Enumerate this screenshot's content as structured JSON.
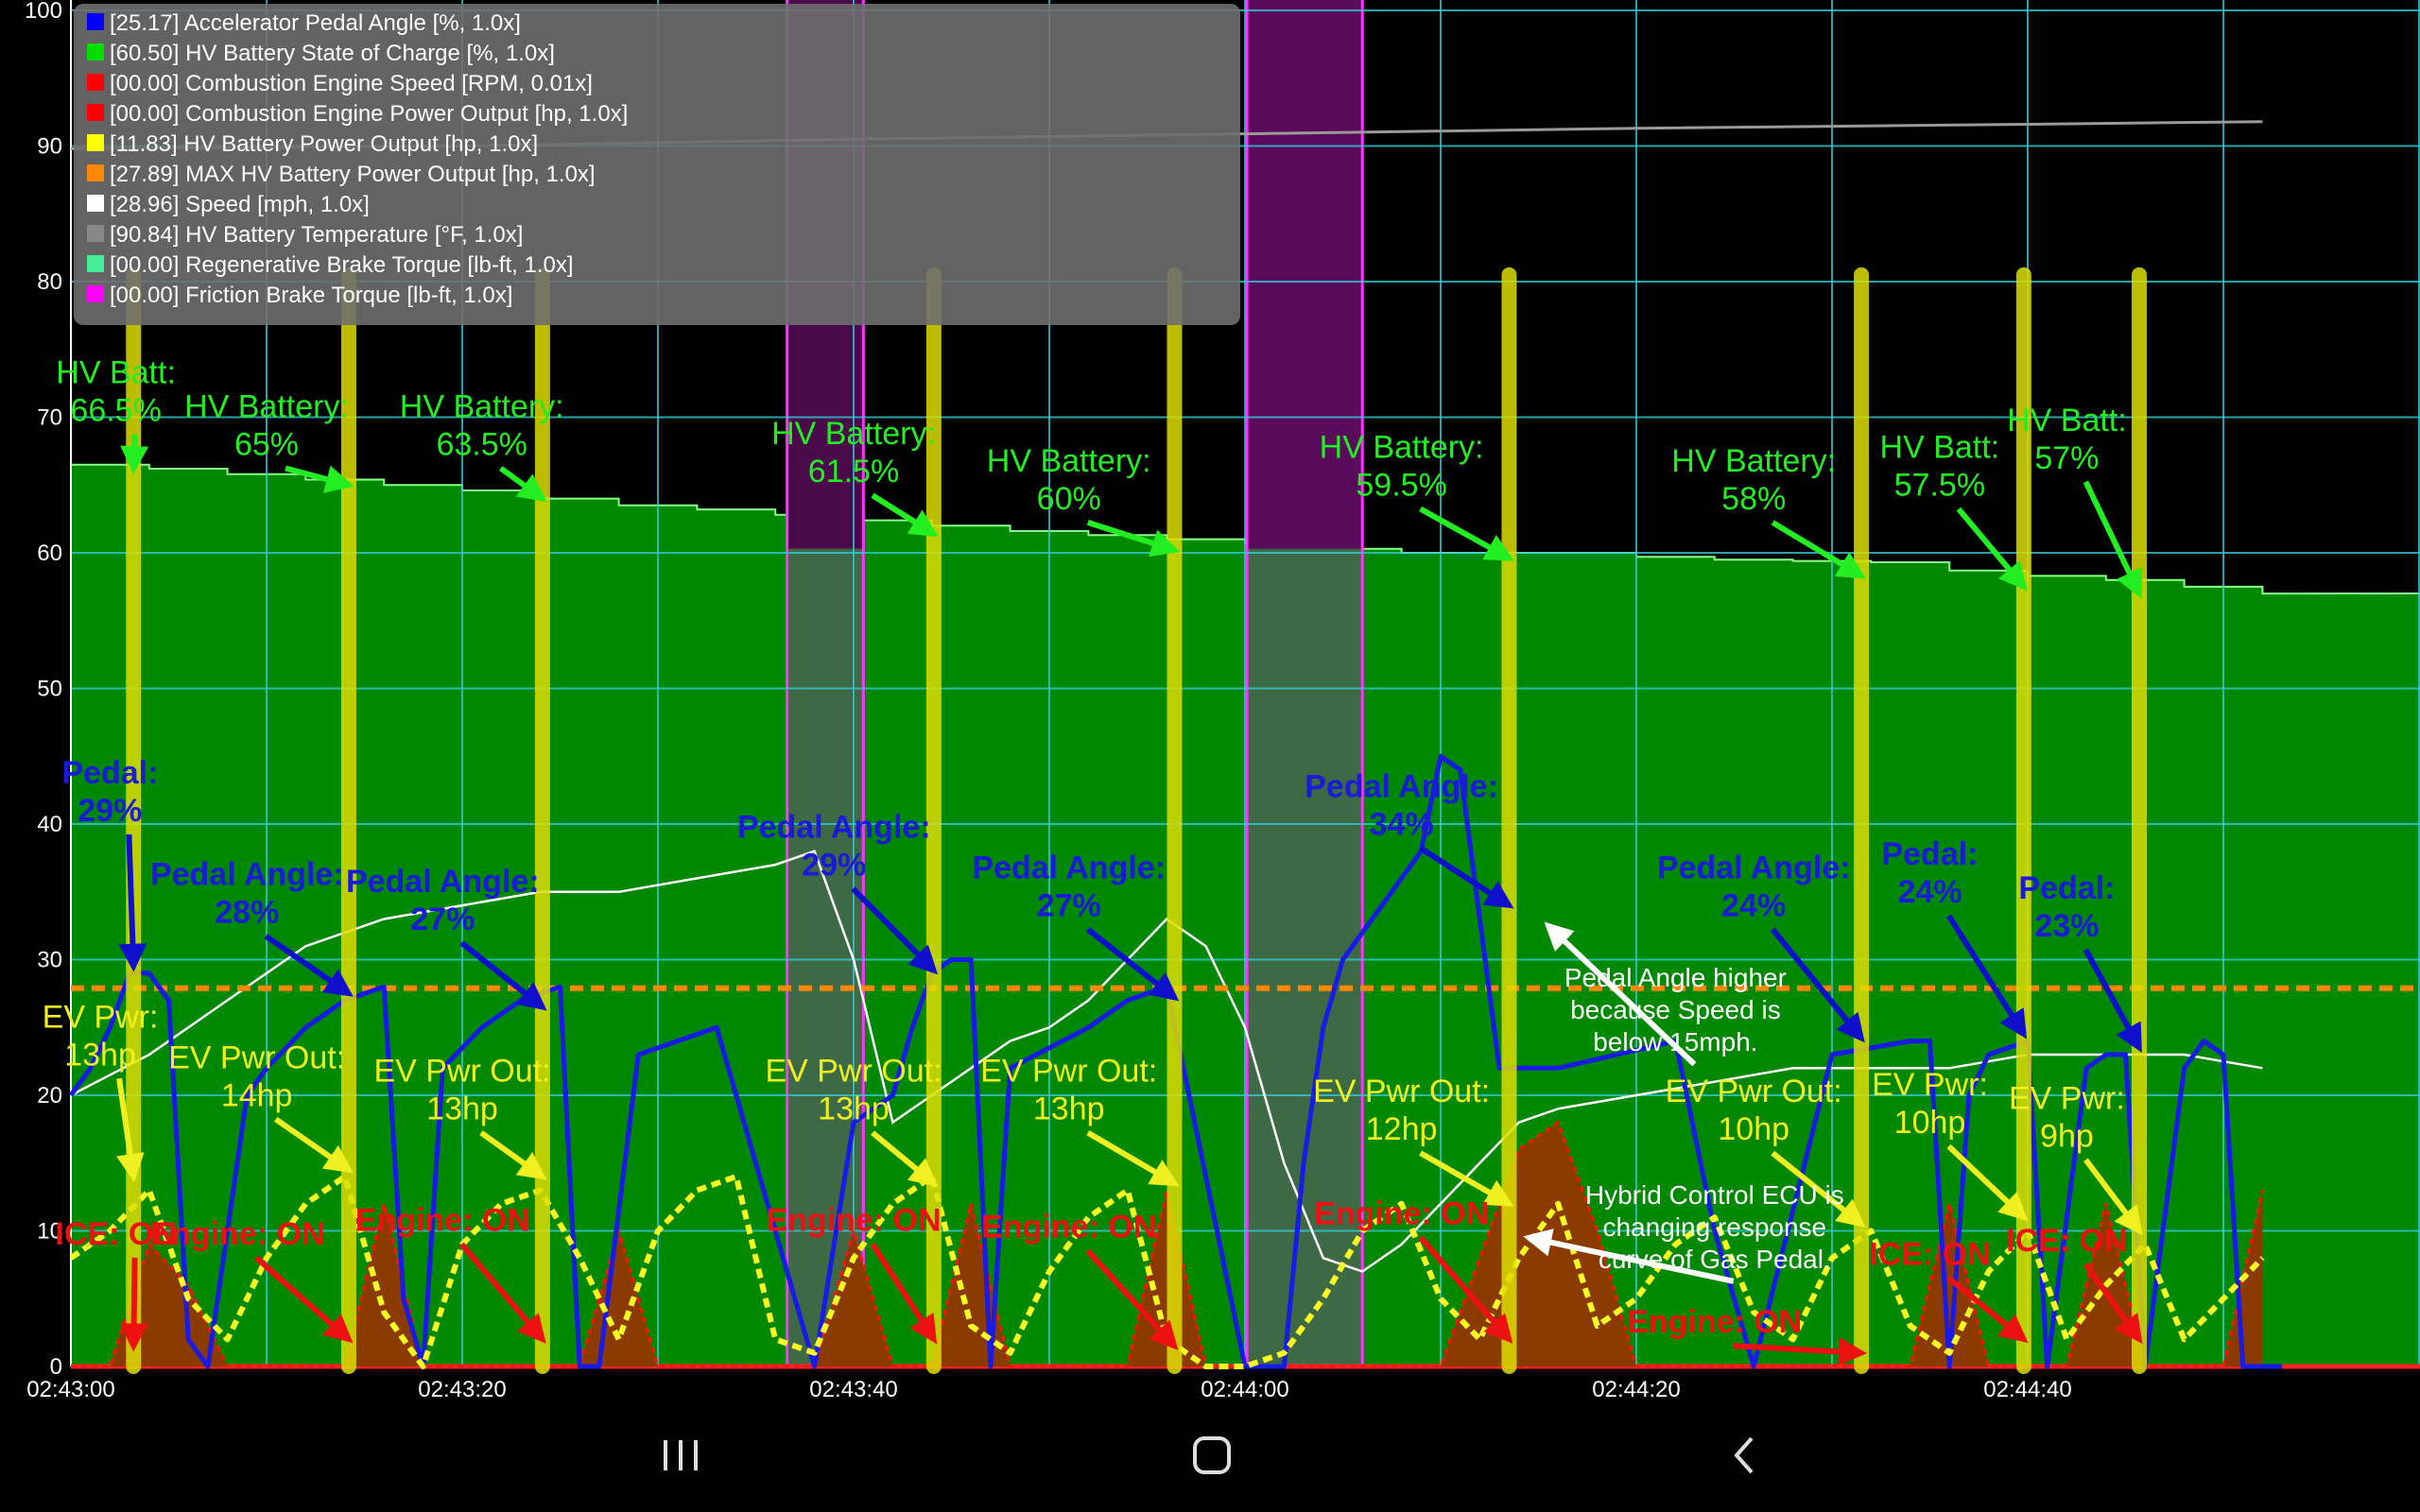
{
  "chart_data": {
    "type": "line",
    "ylim": [
      0,
      100
    ],
    "y_ticks": [
      "0",
      "10",
      "20",
      "30",
      "40",
      "50",
      "60",
      "70",
      "80",
      "90",
      "100"
    ],
    "x_tick_labels": [
      "02:43:00",
      "02:43:20",
      "02:43:40",
      "02:44:00",
      "02:44:20",
      "02:44:40"
    ],
    "legend": [
      {
        "text": "[25.17] Accelerator Pedal Angle [%, 1.0x]",
        "color": "#0000ff"
      },
      {
        "text": "[60.50] HV Battery State of Charge [%, 1.0x]",
        "color": "#00dd00"
      },
      {
        "text": "[00.00] Combustion Engine Speed [RPM, 0.01x]",
        "color": "#ff0000"
      },
      {
        "text": "[00.00] Combustion Engine Power Output [hp, 1.0x]",
        "color": "#ff0000"
      },
      {
        "text": "[11.83] HV Battery Power Output [hp, 1.0x]",
        "color": "#ffff00"
      },
      {
        "text": "[27.89] MAX HV Battery Power Output [hp, 1.0x]",
        "color": "#ff8800"
      },
      {
        "text": "[28.96] Speed [mph, 1.0x]",
        "color": "#ffffff"
      },
      {
        "text": "[90.84] HV Battery Temperature [°F, 1.0x]",
        "color": "#888888"
      },
      {
        "text": "[00.00] Regenerative Brake Torque [lb-ft, 1.0x]",
        "color": "#44ee99"
      },
      {
        "text": "[00.00] Friction Brake Torque [lb-ft, 1.0x]",
        "color": "#ff00ff"
      }
    ],
    "series": [
      {
        "name": "HV Battery State of Charge",
        "x": [
          0,
          4,
          8,
          12,
          16,
          20,
          24,
          28,
          32,
          36,
          40,
          44,
          48,
          52,
          56,
          60,
          64,
          68,
          72,
          76,
          80,
          84,
          88,
          92,
          96,
          100,
          104,
          108,
          112
        ],
        "values": [
          66.5,
          66.2,
          65.8,
          65.4,
          65.0,
          64.6,
          64.0,
          63.5,
          63.2,
          62.8,
          62.4,
          62.0,
          61.6,
          61.3,
          61.0,
          60.7,
          60.3,
          60.0,
          60.0,
          60.0,
          59.7,
          59.5,
          59.4,
          59.3,
          58.7,
          58.3,
          58.0,
          57.5,
          57.0
        ]
      },
      {
        "name": "Accelerator Pedal Angle",
        "x": [
          0,
          1,
          2,
          3,
          4,
          5,
          6,
          7,
          9,
          10,
          12,
          14,
          15,
          16,
          17,
          18,
          19,
          21,
          23,
          24,
          25,
          26,
          27,
          29,
          31,
          33,
          38,
          40,
          42,
          43,
          44,
          45,
          46,
          47,
          48,
          52,
          54,
          56,
          60,
          62,
          63,
          64,
          65,
          67,
          69,
          70,
          71,
          73,
          76,
          79,
          82,
          84,
          86,
          90,
          94,
          95,
          96,
          97,
          98,
          100,
          101,
          103,
          104,
          105,
          106,
          108,
          109,
          110,
          111,
          112,
          113
        ],
        "values": [
          20,
          22,
          25,
          29,
          29,
          27,
          2,
          0,
          20,
          22,
          25,
          27,
          27.5,
          28,
          5,
          0,
          22,
          25,
          27,
          27.5,
          28,
          0,
          0,
          23,
          24,
          25,
          0,
          18,
          20,
          25,
          29,
          30,
          30,
          0,
          22,
          25,
          27,
          28,
          0,
          0,
          15,
          25,
          30,
          34,
          38,
          45,
          44,
          22,
          22,
          23,
          24,
          10,
          0,
          23,
          24,
          24,
          0,
          20,
          23,
          24,
          0,
          22,
          23,
          23,
          0,
          22,
          24,
          23,
          0,
          0,
          0
        ]
      },
      {
        "name": "HV Battery Power Output",
        "x": [
          0,
          2,
          4,
          6,
          8,
          10,
          12,
          14,
          16,
          18,
          20,
          22,
          24,
          26,
          28,
          30,
          32,
          34,
          36,
          38,
          40,
          42,
          44,
          46,
          48,
          50,
          52,
          54,
          56,
          58,
          60,
          62,
          64,
          66,
          68,
          70,
          72,
          74,
          76,
          78,
          80,
          82,
          84,
          86,
          88,
          90,
          92,
          94,
          96,
          98,
          100,
          102,
          104,
          106,
          108,
          110,
          112
        ],
        "values": [
          8,
          10,
          13,
          5,
          2,
          8,
          12,
          14,
          4,
          0,
          9,
          12,
          13,
          8,
          2,
          10,
          13,
          14,
          2,
          1,
          8,
          12,
          14,
          3,
          1,
          7,
          11,
          13,
          2,
          0,
          0,
          1,
          5,
          10,
          12,
          5,
          2,
          8,
          12,
          3,
          5,
          9,
          11,
          4,
          2,
          8,
          10,
          3,
          1,
          7,
          10,
          2,
          6,
          9,
          2,
          5,
          8
        ]
      },
      {
        "name": "Combustion Engine Power Output",
        "x": [
          0,
          2,
          4,
          6,
          8,
          10,
          12,
          14,
          16,
          18,
          20,
          22,
          24,
          26,
          28,
          30,
          32,
          34,
          36,
          38,
          40,
          42,
          44,
          46,
          48,
          50,
          52,
          54,
          56,
          58,
          60,
          62,
          64,
          66,
          68,
          70,
          72,
          74,
          76,
          78,
          80,
          82,
          84,
          86,
          88,
          90,
          92,
          94,
          96,
          98,
          100,
          102,
          104,
          106,
          108,
          110,
          112
        ],
        "values": [
          0,
          0,
          9,
          6,
          0,
          0,
          0,
          0,
          12,
          0,
          0,
          0,
          0,
          0,
          10,
          0,
          0,
          0,
          0,
          0,
          10,
          0,
          0,
          12,
          0,
          0,
          0,
          0,
          13,
          0,
          0,
          0,
          0,
          0,
          0,
          0,
          8,
          16,
          18,
          10,
          0,
          0,
          0,
          0,
          0,
          0,
          0,
          0,
          12,
          0,
          0,
          0,
          12,
          0,
          0,
          0,
          13
        ]
      },
      {
        "name": "Speed",
        "x": [
          0,
          4,
          8,
          12,
          16,
          20,
          24,
          28,
          32,
          36,
          38,
          40,
          42,
          44,
          46,
          48,
          50,
          52,
          54,
          56,
          58,
          60,
          62,
          64,
          66,
          68,
          70,
          72,
          74,
          76,
          80,
          84,
          88,
          92,
          96,
          100,
          104,
          108,
          112
        ],
        "values": [
          20,
          23,
          27,
          31,
          33,
          34,
          35,
          35,
          36,
          37,
          38,
          30,
          18,
          20,
          22,
          24,
          25,
          27,
          30,
          33,
          31,
          25,
          15,
          8,
          7,
          9,
          12,
          15,
          18,
          19,
          20,
          21,
          22,
          22,
          22,
          23,
          23,
          23,
          22
        ]
      },
      {
        "name": "HV Battery Temperature",
        "x": [
          0,
          20,
          40,
          60,
          80,
          100,
          112
        ],
        "values": [
          89.8,
          90.0,
          90.5,
          90.9,
          91.3,
          91.6,
          91.8
        ]
      },
      {
        "name": "MAX HV Battery Power Output",
        "x": [
          0,
          112
        ],
        "values": [
          27.89,
          27.89
        ]
      }
    ],
    "brake_regions": [
      {
        "x_start": 36.6,
        "x_end": 40.5,
        "type": "regen"
      },
      {
        "x_start": 60.1,
        "x_end": 66.0,
        "type": "friction"
      }
    ],
    "markers": [
      3.2,
      14.2,
      24.1,
      44.1,
      56.4,
      73.5,
      91.5,
      99.8,
      105.7
    ],
    "annotations": [
      {
        "text": "HV Batt:\n66.5%",
        "color": "green",
        "lx": 2.3,
        "ly": 72.5,
        "tx": 3.2,
        "ty": 66.2
      },
      {
        "text": "HV Battery:\n65%",
        "color": "green",
        "lx": 10,
        "ly": 70,
        "tx": 14.2,
        "ty": 65.0
      },
      {
        "text": "HV Battery:\n63.5%",
        "color": "green",
        "lx": 21,
        "ly": 70,
        "tx": 24.1,
        "ty": 64.0
      },
      {
        "text": "HV Battery:\n61.5%",
        "color": "green",
        "lx": 40,
        "ly": 68,
        "tx": 44.1,
        "ty": 61.4
      },
      {
        "text": "HV Battery:\n60%",
        "color": "green",
        "lx": 51,
        "ly": 66,
        "tx": 56.4,
        "ty": 60.2
      },
      {
        "text": "HV Battery:\n59.5%",
        "color": "green",
        "lx": 68,
        "ly": 67,
        "tx": 73.5,
        "ty": 59.6
      },
      {
        "text": "HV Battery:\n58%",
        "color": "green",
        "lx": 86,
        "ly": 66,
        "tx": 91.5,
        "ty": 58.3
      },
      {
        "text": "HV Batt:\n57.5%",
        "color": "green",
        "lx": 95.5,
        "ly": 67,
        "tx": 99.8,
        "ty": 57.5
      },
      {
        "text": "HV Batt:\n57%",
        "color": "green",
        "lx": 102,
        "ly": 69,
        "tx": 105.7,
        "ty": 57.0
      },
      {
        "text": "Pedal:\n29%",
        "color": "blue",
        "lx": 2,
        "ly": 43,
        "tx": 3.2,
        "ty": 29.5
      },
      {
        "text": "Pedal Angle:\n28%",
        "color": "blue",
        "lx": 9,
        "ly": 35.5,
        "tx": 14.2,
        "ty": 27.5
      },
      {
        "text": "Pedal Angle:\n27%",
        "color": "blue",
        "lx": 19,
        "ly": 35,
        "tx": 24.1,
        "ty": 26.5
      },
      {
        "text": "Pedal Angle:\n29%",
        "color": "blue",
        "lx": 39,
        "ly": 39,
        "tx": 44.1,
        "ty": 29.2
      },
      {
        "text": "Pedal Angle:\n27%",
        "color": "blue",
        "lx": 51,
        "ly": 36,
        "tx": 56.4,
        "ty": 27.2
      },
      {
        "text": "Pedal Angle:\n34%",
        "color": "blue",
        "lx": 68,
        "ly": 42,
        "tx": 73.5,
        "ty": 34.0
      },
      {
        "text": "Pedal Angle:\n24%",
        "color": "blue",
        "lx": 86,
        "ly": 36,
        "tx": 91.5,
        "ty": 24.2
      },
      {
        "text": "Pedal:\n24%",
        "color": "blue",
        "lx": 95,
        "ly": 37,
        "tx": 99.8,
        "ty": 24.5
      },
      {
        "text": "Pedal:\n23%",
        "color": "blue",
        "lx": 102,
        "ly": 34.5,
        "tx": 105.7,
        "ty": 23.5
      },
      {
        "text": "EV Pwr:\n13hp",
        "color": "yellow",
        "lx": 1.5,
        "ly": 25,
        "tx": 3.2,
        "ty": 14
      },
      {
        "text": "EV Pwr Out:\n14hp",
        "color": "yellow",
        "lx": 9.5,
        "ly": 22,
        "tx": 14.2,
        "ty": 14.5
      },
      {
        "text": "EV Pwr Out:\n13hp",
        "color": "yellow",
        "lx": 20,
        "ly": 21,
        "tx": 24.1,
        "ty": 14
      },
      {
        "text": "EV Pwr Out:\n13hp",
        "color": "yellow",
        "lx": 40,
        "ly": 21,
        "tx": 44.1,
        "ty": 13.5
      },
      {
        "text": "EV Pwr Out:\n13hp",
        "color": "yellow",
        "lx": 51,
        "ly": 21,
        "tx": 56.4,
        "ty": 13.5
      },
      {
        "text": "EV Pwr Out:\n12hp",
        "color": "yellow",
        "lx": 68,
        "ly": 19.5,
        "tx": 73.5,
        "ty": 12
      },
      {
        "text": "EV Pwr Out:\n10hp",
        "color": "yellow",
        "lx": 86,
        "ly": 19.5,
        "tx": 91.5,
        "ty": 10.5
      },
      {
        "text": "EV Pwr:\n10hp",
        "color": "yellow",
        "lx": 95,
        "ly": 20,
        "tx": 99.8,
        "ty": 11
      },
      {
        "text": "EV Pwr:\n9hp",
        "color": "yellow",
        "lx": 102,
        "ly": 19,
        "tx": 105.7,
        "ty": 10
      },
      {
        "text": "ICE: ON",
        "color": "red",
        "lx": 2.3,
        "ly": 9,
        "tx": 3.2,
        "ty": 1.5
      },
      {
        "text": "Engine: ON",
        "color": "red",
        "lx": 8.5,
        "ly": 9,
        "tx": 14.2,
        "ty": 2
      },
      {
        "text": "Engine: ON",
        "color": "red",
        "lx": 19,
        "ly": 10,
        "tx": 24.1,
        "ty": 2
      },
      {
        "text": "Engine: ON",
        "color": "red",
        "lx": 40,
        "ly": 10,
        "tx": 44.1,
        "ty": 2
      },
      {
        "text": "Engine: ON",
        "color": "red",
        "lx": 51,
        "ly": 9.5,
        "tx": 56.4,
        "ty": 1.5
      },
      {
        "text": "Engine: ON",
        "color": "red",
        "lx": 68,
        "ly": 10.5,
        "tx": 73.5,
        "ty": 2
      },
      {
        "text": "Engine: ON",
        "color": "red",
        "lx": 84,
        "ly": 2.5,
        "tx": 91.5,
        "ty": 1
      },
      {
        "text": "ICE: ON",
        "color": "red",
        "lx": 95,
        "ly": 7.5,
        "tx": 99.8,
        "ty": 2
      },
      {
        "text": "ICE: ON",
        "color": "red",
        "lx": 102,
        "ly": 8.5,
        "tx": 105.7,
        "ty": 2
      }
    ],
    "notes": [
      {
        "text": "Pedal Angle higher\nbecause Speed is\nbelow 15mph.",
        "lx": 82,
        "ly": 28,
        "tx": 75.5,
        "ty": 32.5
      },
      {
        "text": "Hybrid Control ECU is\nchanging response\ncurve of Gas Pedal.",
        "lx": 84,
        "ly": 12,
        "tx": 74.5,
        "ty": 9.5
      }
    ]
  },
  "colors": {
    "soc_fill": "#008800",
    "soc_line": "#88ff88",
    "pedal": "#1a1ae6",
    "ev_power": "#ffff22",
    "engine": "#8b3b00",
    "engine_line": "#ff1111",
    "speed": "#ffffff",
    "max_power": "#ff8800",
    "marker": "#dddd00",
    "grid": "#36c8d8",
    "regen": "#3a5a3a",
    "friction": "#ff33ff"
  },
  "nav": {
    "recents_icon": "recents-icon",
    "home_icon": "home-icon",
    "back_icon": "back-icon"
  }
}
